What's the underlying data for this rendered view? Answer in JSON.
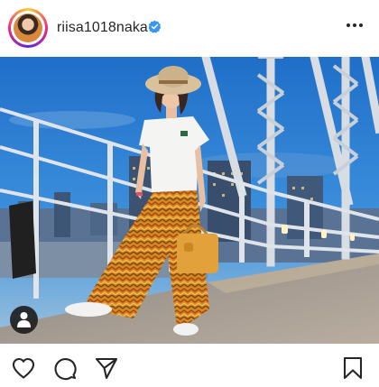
{
  "post": {
    "username": "riisa1018naka",
    "verified": true
  },
  "icons": {
    "verified": "verified-badge-icon",
    "more": "more-options-icon",
    "user_tag": "user-tag-icon",
    "like": "heart-icon",
    "comment": "comment-icon",
    "share": "share-icon",
    "save": "bookmark-icon"
  },
  "colors": {
    "text": "#262626",
    "verified_blue": "#3897f0",
    "sky": "#2b7fd0"
  }
}
